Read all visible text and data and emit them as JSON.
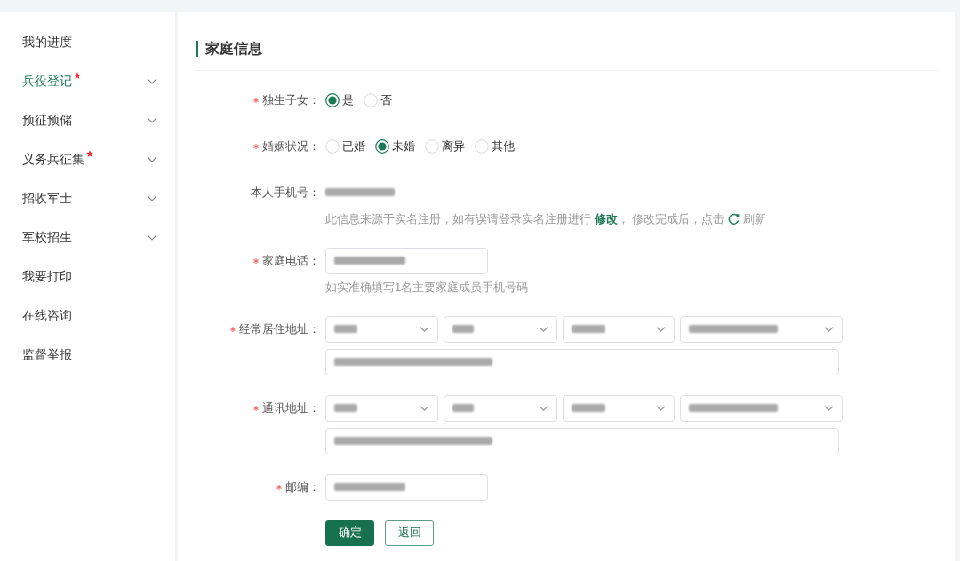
{
  "sidebar": {
    "items": [
      {
        "label": "我的进度",
        "selected": false,
        "required": false,
        "expandable": false
      },
      {
        "label": "兵役登记",
        "selected": true,
        "required": true,
        "expandable": true
      },
      {
        "label": "预征预储",
        "selected": false,
        "required": false,
        "expandable": true
      },
      {
        "label": "义务兵征集",
        "selected": false,
        "required": true,
        "expandable": true
      },
      {
        "label": "招收军士",
        "selected": false,
        "required": false,
        "expandable": true
      },
      {
        "label": "军校招生",
        "selected": false,
        "required": false,
        "expandable": true
      },
      {
        "label": "我要打印",
        "selected": false,
        "required": false,
        "expandable": false
      },
      {
        "label": "在线咨询",
        "selected": false,
        "required": false,
        "expandable": false
      },
      {
        "label": "监督举报",
        "selected": false,
        "required": false,
        "expandable": false
      }
    ]
  },
  "section": {
    "title": "家庭信息"
  },
  "form": {
    "fields": [
      {
        "kind": "radio",
        "label": "独生子女：",
        "required": true,
        "options": [
          {
            "label": "是",
            "selected": true
          },
          {
            "label": "否",
            "selected": false
          }
        ]
      },
      {
        "kind": "radio",
        "label": "婚姻状况：",
        "required": true,
        "options": [
          {
            "label": "已婚",
            "selected": false
          },
          {
            "label": "未婚",
            "selected": true
          },
          {
            "label": "离异",
            "selected": false
          },
          {
            "label": "其他",
            "selected": false
          }
        ]
      },
      {
        "kind": "static",
        "label": "本人手机号：",
        "required": false,
        "redacted": true,
        "help": {
          "text": "此信息来源于实名注册，如有误请登录实名注册进行 ",
          "link": "修改",
          "text_after": "， 修改完成后，点击",
          "action": "刷新"
        }
      },
      {
        "kind": "input",
        "label": "家庭电话：",
        "required": true,
        "redacted": true,
        "help": {
          "text": "如实准确填写1名主要家庭成员手机号码"
        }
      },
      {
        "kind": "address",
        "label": "经常居住地址：",
        "required": true,
        "selects": [
          {
            "redacted": true
          },
          {
            "redacted": true
          },
          {
            "redacted": true
          },
          {
            "redacted": true
          }
        ],
        "detail": {
          "redacted": true
        }
      },
      {
        "kind": "address",
        "label": "通讯地址：",
        "required": true,
        "selects": [
          {
            "redacted": true
          },
          {
            "redacted": true
          },
          {
            "redacted": true
          },
          {
            "redacted": true
          }
        ],
        "detail": {
          "redacted": true
        }
      },
      {
        "kind": "input",
        "label": "邮编：",
        "required": true,
        "redacted": true
      }
    ]
  },
  "buttons": [
    {
      "label": "确定",
      "kind": "primary"
    },
    {
      "label": "返回",
      "kind": "outline"
    }
  ]
}
